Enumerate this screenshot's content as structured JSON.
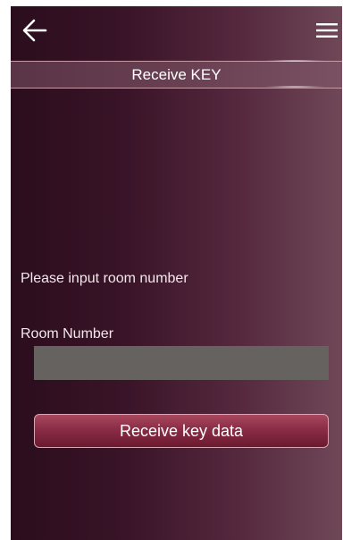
{
  "header": {
    "back_icon": "arrow-left-icon",
    "menu_icon": "hamburger-menu-icon",
    "title": "Receive KEY"
  },
  "form": {
    "prompt": "Please input room number",
    "room_label": "Room Number",
    "room_value": "",
    "submit_label": "Receive key data"
  },
  "colors": {
    "background_dark": "#2a0d1d",
    "background_light": "#6f4858",
    "input_fill": "#65625f",
    "button_fill": "#8a2c45",
    "button_border": "#d9a6b2"
  }
}
